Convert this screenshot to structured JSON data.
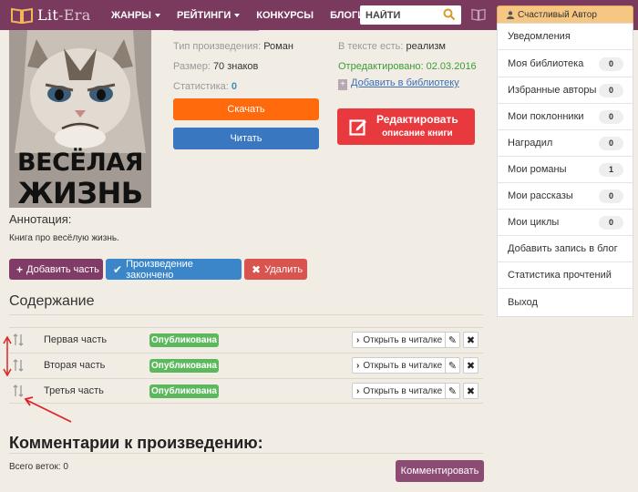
{
  "navbar": {
    "brand_part1": "Lit",
    "brand_part2": "-Era",
    "items": [
      "ЖАНРЫ",
      "РЕЙТИНГИ",
      "КОНКУРСЫ",
      "БЛОГИ"
    ],
    "search_placeholder": "НАЙТИ",
    "user_label": "Счастливый Автор"
  },
  "book": {
    "cover_title_line1": "ВЕСЁЛАЯ",
    "cover_title_line2": "ЖИЗНЬ",
    "type_label": "Тип произведения:",
    "type_value": "Роман",
    "size_label": "Размер:",
    "size_value": "70 знаков",
    "stats_label": "Статистика:",
    "stats_value": "0",
    "text_has_label": "В тексте есть:",
    "text_has_value": "реализм",
    "edited": "Отредактировано: 02.03.2016",
    "add_library": "Добавить в библиотеку",
    "download": "Скачать",
    "read": "Читать",
    "edit_line1": "Редактировать",
    "edit_line2": "описание книги",
    "annotation_heading": "Аннотация:",
    "annotation_text": "Книга про весёлую жизнь."
  },
  "actions": {
    "add_part": "Добавить часть",
    "finished": "Произведение закончено",
    "delete": "Удалить"
  },
  "contents": {
    "heading": "Содержание",
    "open_label": "Открыть в читалке",
    "status_label": "Опубликована",
    "chapters": [
      {
        "title": "Первая часть"
      },
      {
        "title": "Вторая часть"
      },
      {
        "title": "Третья часть"
      }
    ]
  },
  "comments": {
    "heading": "Комментарии к произведению:",
    "threads": "Всего веток: 0",
    "button": "Комментировать"
  },
  "sidebar": {
    "items": [
      {
        "label": "Уведомления"
      },
      {
        "label": "Моя библиотека",
        "count": "0"
      },
      {
        "label": "Избранные авторы",
        "count": "0"
      },
      {
        "label": "Мои поклонники",
        "count": "0"
      },
      {
        "label": "Наградил",
        "count": "0"
      },
      {
        "label": "Мои романы",
        "count": "1"
      },
      {
        "label": "Мои рассказы",
        "count": "0"
      },
      {
        "label": "Мои циклы",
        "count": "0"
      },
      {
        "label": "Добавить запись в блог"
      },
      {
        "label": "Статистика прочтений"
      },
      {
        "label": "Выход"
      }
    ]
  },
  "colors": {
    "navbar": "#7a3a5e",
    "download": "#ff6a0d",
    "read": "#3978c1",
    "edit": "#e8393f",
    "published": "#5cb85c",
    "annotation_arrows": "#d9252a"
  },
  "icons": [
    "book-logo-icon",
    "search-icon",
    "book-icon",
    "user-icon",
    "plus-icon",
    "edit-icon",
    "check-icon",
    "close-icon",
    "sort-icon",
    "chevron-right-icon",
    "pencil-icon"
  ]
}
